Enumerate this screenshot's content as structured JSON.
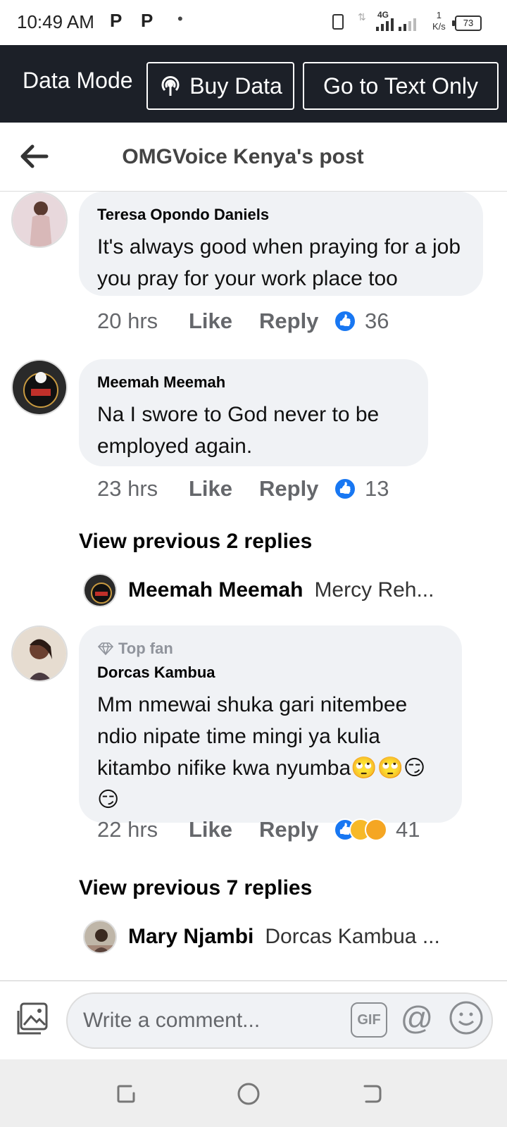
{
  "status_bar": {
    "time": "10:49 AM",
    "notif1": "P",
    "notif2": "P",
    "dot": "•",
    "network": "4G",
    "speed_value": "1",
    "speed_unit": "K/s",
    "battery": "73"
  },
  "data_bar": {
    "label": "Data Mode",
    "buy_data": "Buy Data",
    "text_only": "Go to Text Only",
    "buy_icon": "broadcast-icon"
  },
  "header": {
    "title": "OMGVoice Kenya's post",
    "back_icon": "back-arrow-icon"
  },
  "comments": [
    {
      "name": "Teresa Opondo Daniels",
      "text": "It's always good when praying for a job you pray for your work place too",
      "time": "20 hrs",
      "like": "Like",
      "reply": "Reply",
      "reactions": "36"
    },
    {
      "name": "Meemah Meemah",
      "text": "Na I swore to God never to be employed again.",
      "time": "23 hrs",
      "like": "Like",
      "reply": "Reply",
      "reactions": "13",
      "view_previous": "View previous 2 replies",
      "reply_preview": {
        "name": "Meemah Meemah",
        "snippet": "Mercy Reh..."
      }
    },
    {
      "badge": "Top fan",
      "name": "Dorcas Kambua",
      "text": "Mm nmewai shuka gari nitembee ndio nipate time mingi ya kulia kitambo nifike kwa nyumba🙄🙄😏😏",
      "time": "22 hrs",
      "like": "Like",
      "reply": "Reply",
      "reactions": "41",
      "view_previous": "View previous 7 replies",
      "reply_preview": {
        "name": "Mary Njambi",
        "snippet": "Dorcas Kambua ..."
      }
    }
  ],
  "composer": {
    "placeholder": "Write a comment...",
    "gif": "GIF",
    "at": "@"
  },
  "colors": {
    "data_bar_bg": "#1c2028",
    "bubble_bg": "#f0f2f5",
    "like_blue": "#1877f2"
  }
}
